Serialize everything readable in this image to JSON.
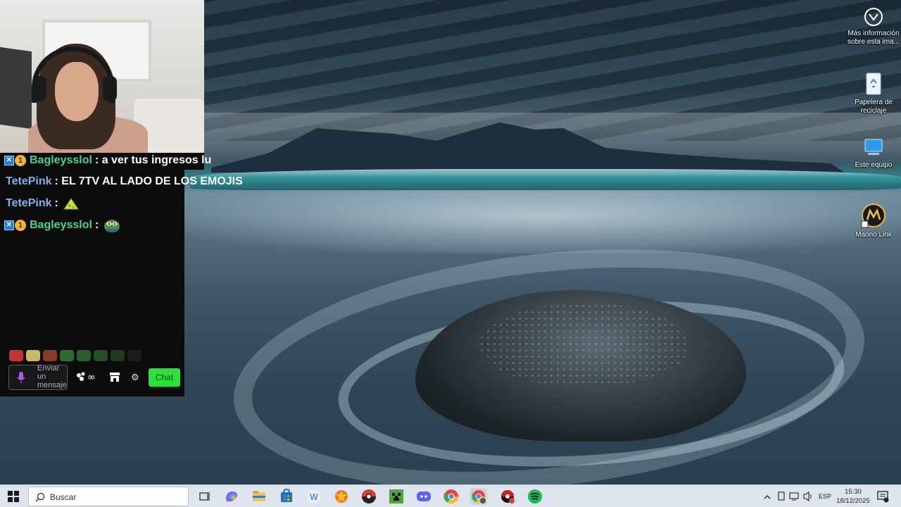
{
  "stream": {
    "chat_messages": [
      {
        "user": "Bagleysslol",
        "text": ": a ver tus ingresos lu",
        "badges": [
          "prime",
          "1"
        ],
        "color": "#3fd394"
      },
      {
        "user": "TetePink",
        "text": ": EL 7TV AL LADO DE LOS EMOJIS",
        "badges": [],
        "color": "#7fb3e8"
      },
      {
        "user": "TetePink",
        "text": ":",
        "badges": [],
        "color": "#7fb3e8",
        "emote": "pizza-emote"
      },
      {
        "user": "Bagleysslol",
        "text": ":",
        "badges": [
          "prime",
          "1"
        ],
        "color": "#3fd394",
        "emote": "pepe-emote"
      }
    ],
    "input_placeholder": "Enviar un mensaje",
    "chat_button": "Chat",
    "cheer_label": "∞"
  },
  "desktop": {
    "icons": [
      {
        "label": "Más información sobre esta ima...",
        "icon": "camera-info-icon"
      },
      {
        "label": "Papelera de reciclaje",
        "icon": "recycle-bin-icon"
      },
      {
        "label": "Este equipo",
        "icon": "computer-icon"
      },
      {
        "label": "Maono Link",
        "icon": "maono-link-icon"
      }
    ]
  },
  "taskbar": {
    "search_placeholder": "Buscar",
    "apps": [
      "task-view",
      "copilot",
      "file-explorer",
      "microsoft-store",
      "wps-office",
      "app-orange",
      "pokeball-app",
      "minecraft",
      "discord",
      "chrome",
      "chrome-profile",
      "pokemon-app",
      "spotify"
    ],
    "language": "ESP",
    "time": "15:30",
    "date": "18/12/2025"
  },
  "colors": {
    "chat_button": "#29e33a",
    "taskbar": "#dde4ee",
    "chat_bg": "#0c0c0d"
  }
}
